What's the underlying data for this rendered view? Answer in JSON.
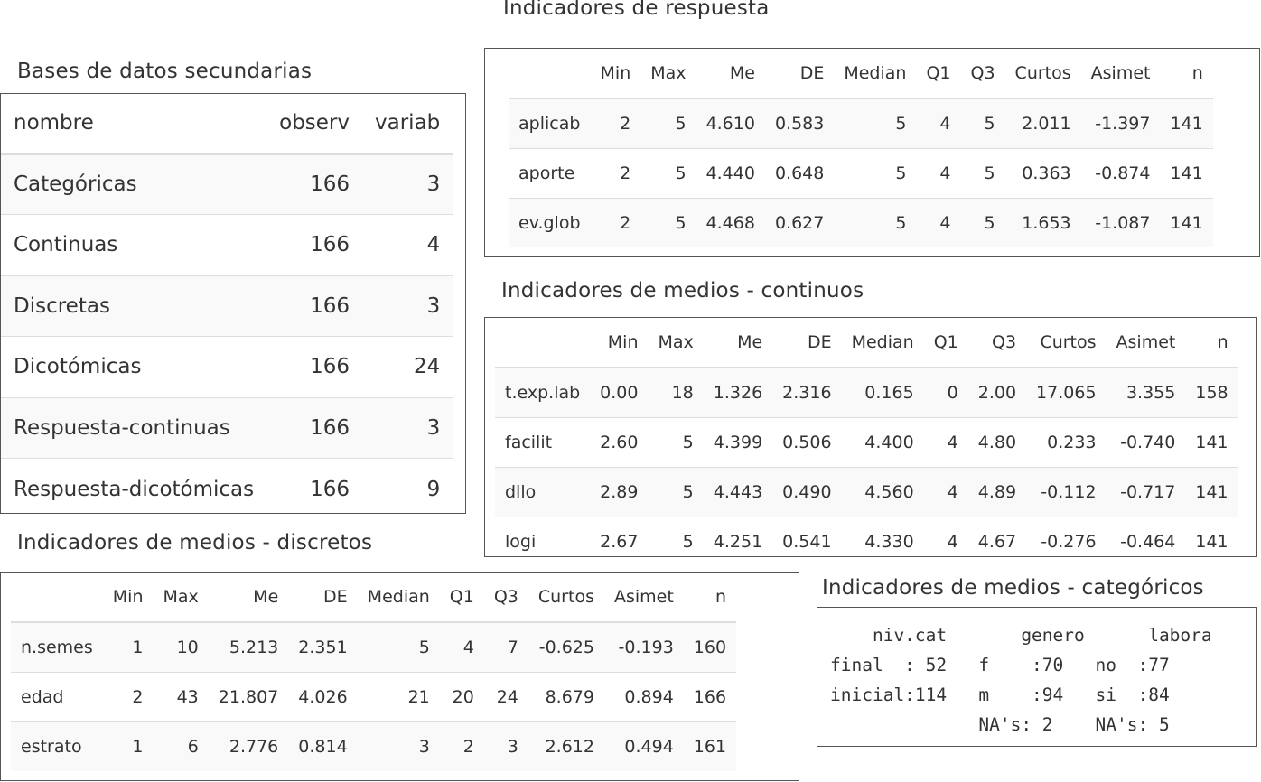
{
  "titles": {
    "respuesta": "Indicadores de respuesta",
    "bases": "Bases de datos secundarias",
    "continuos": "Indicadores de medios - continuos",
    "discretos": "Indicadores de medios - discretos",
    "categoricos": "Indicadores de medios - categóricos"
  },
  "bases": {
    "columns": [
      "nombre",
      "observ",
      "variab"
    ],
    "rows": [
      [
        "Categóricas",
        "166",
        "3"
      ],
      [
        "Continuas",
        "166",
        "4"
      ],
      [
        "Discretas",
        "166",
        "3"
      ],
      [
        "Dicotómicas",
        "166",
        "24"
      ],
      [
        "Respuesta-continuas",
        "166",
        "3"
      ],
      [
        "Respuesta-dicotómicas",
        "166",
        "9"
      ]
    ]
  },
  "respuesta": {
    "columns": [
      "",
      "Min",
      "Max",
      "Me",
      "DE",
      "Median",
      "Q1",
      "Q3",
      "Curtos",
      "Asimet",
      "n"
    ],
    "rows": [
      [
        "aplicab",
        "2",
        "5",
        "4.610",
        "0.583",
        "5",
        "4",
        "5",
        "2.011",
        "-1.397",
        "141"
      ],
      [
        "aporte",
        "2",
        "5",
        "4.440",
        "0.648",
        "5",
        "4",
        "5",
        "0.363",
        "-0.874",
        "141"
      ],
      [
        "ev.glob",
        "2",
        "5",
        "4.468",
        "0.627",
        "5",
        "4",
        "5",
        "1.653",
        "-1.087",
        "141"
      ]
    ]
  },
  "continuos": {
    "columns": [
      "",
      "Min",
      "Max",
      "Me",
      "DE",
      "Median",
      "Q1",
      "Q3",
      "Curtos",
      "Asimet",
      "n"
    ],
    "rows": [
      [
        "t.exp.lab",
        "0.00",
        "18",
        "1.326",
        "2.316",
        "0.165",
        "0",
        "2.00",
        "17.065",
        "3.355",
        "158"
      ],
      [
        "facilit",
        "2.60",
        "5",
        "4.399",
        "0.506",
        "4.400",
        "4",
        "4.80",
        "0.233",
        "-0.740",
        "141"
      ],
      [
        "dllo",
        "2.89",
        "5",
        "4.443",
        "0.490",
        "4.560",
        "4",
        "4.89",
        "-0.112",
        "-0.717",
        "141"
      ],
      [
        "logi",
        "2.67",
        "5",
        "4.251",
        "0.541",
        "4.330",
        "4",
        "4.67",
        "-0.276",
        "-0.464",
        "141"
      ]
    ]
  },
  "discretos": {
    "columns": [
      "",
      "Min",
      "Max",
      "Me",
      "DE",
      "Median",
      "Q1",
      "Q3",
      "Curtos",
      "Asimet",
      "n"
    ],
    "rows": [
      [
        "n.semes",
        "1",
        "10",
        "5.213",
        "2.351",
        "5",
        "4",
        "7",
        "-0.625",
        "-0.193",
        "160"
      ],
      [
        "edad",
        "2",
        "43",
        "21.807",
        "4.026",
        "21",
        "20",
        "24",
        "8.679",
        "0.894",
        "166"
      ],
      [
        "estrato",
        "1",
        "6",
        "2.776",
        "0.814",
        "3",
        "2",
        "3",
        "2.612",
        "0.494",
        "161"
      ]
    ]
  },
  "categoricos": {
    "lines": [
      "    niv.cat       genero      labora",
      "final  : 52   f    :70   no  :77",
      "inicial:114   m    :94   si  :84",
      "              NA's: 2    NA's: 5"
    ]
  }
}
